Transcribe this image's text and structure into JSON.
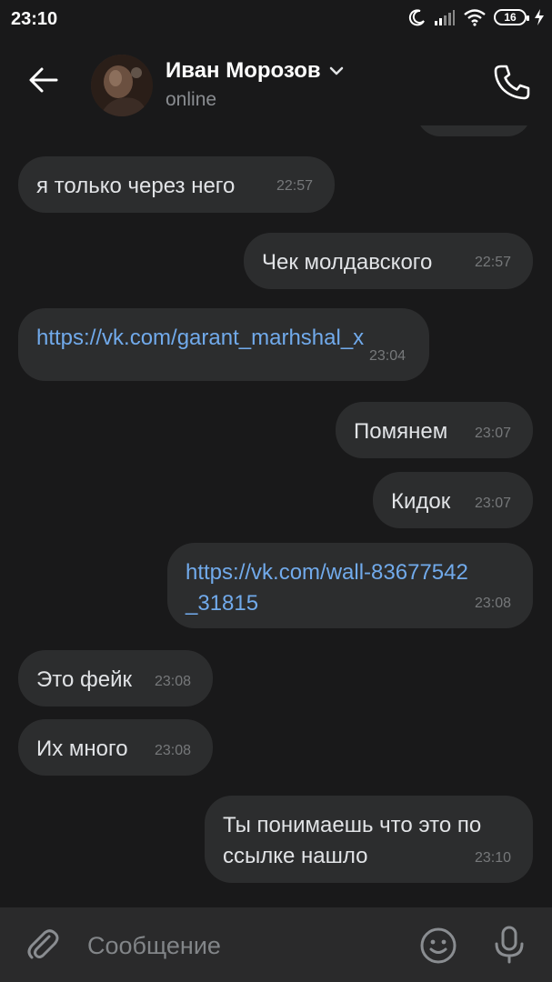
{
  "status_bar": {
    "time": "23:10",
    "battery": "16"
  },
  "header": {
    "name": "Иван Морозов",
    "status": "online"
  },
  "messages": [
    {
      "text": "я только через него",
      "time": "22:57",
      "direction": "in",
      "type": "text"
    },
    {
      "text": "Чек молдавского",
      "time": "22:57",
      "direction": "out",
      "type": "text"
    },
    {
      "text": "https://vk.com/garant_marhshal_x",
      "time": "23:04",
      "direction": "in",
      "type": "link"
    },
    {
      "text": "Помянем",
      "time": "23:07",
      "direction": "out",
      "type": "text"
    },
    {
      "text": "Кидок",
      "time": "23:07",
      "direction": "out",
      "type": "text"
    },
    {
      "text": "https://vk.com/wall-83677542\n_31815",
      "time": "23:08",
      "direction": "out",
      "type": "link"
    },
    {
      "text": "Это фейк",
      "time": "23:08",
      "direction": "in",
      "type": "text"
    },
    {
      "text": "Их много",
      "time": "23:08",
      "direction": "in",
      "type": "text"
    },
    {
      "text": "Ты понимаешь что это по\nссылке нашло",
      "time": "23:10",
      "direction": "out",
      "type": "text"
    }
  ],
  "composer": {
    "placeholder": "Сообщение"
  },
  "colors": {
    "background": "#19191a",
    "bubble": "#2c2d2e",
    "link": "#71aaeb",
    "timestamp": "#76787a"
  }
}
